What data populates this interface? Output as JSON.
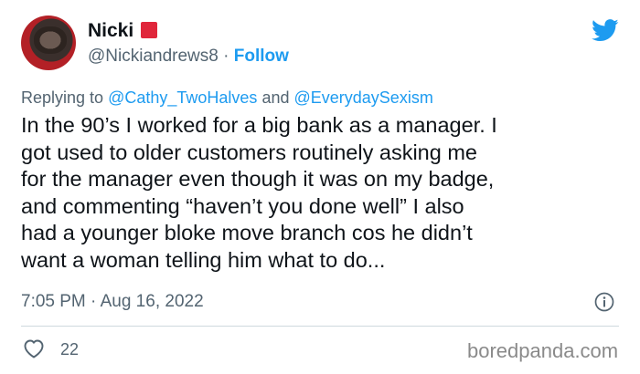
{
  "user": {
    "name": "Nicki",
    "handle": "@Nickiandrews8",
    "separator": "·",
    "follow_label": "Follow"
  },
  "reply": {
    "prefix": "Replying to",
    "mention1": "@Cathy_TwoHalves",
    "joiner": "and",
    "mention2": "@EverydaySexism"
  },
  "tweet": {
    "text": "In the 90’s I worked for a big bank as a manager. I\ngot used to older customers routinely asking  me\nfor the manager even though it was on my badge,\nand commenting “haven’t you done well” I also\nhad a younger bloke move branch cos he didn’t\nwant a woman telling him what to do...",
    "timestamp": "7:05 PM · Aug 16, 2022"
  },
  "stats": {
    "likes": "22"
  },
  "watermark": "boredpanda.com",
  "colors": {
    "accent": "#1d9bf0",
    "text": "#0f1419",
    "secondary": "#536471",
    "flag": "#e0263b"
  },
  "icons": [
    "twitter-bird-icon",
    "info-icon",
    "heart-icon",
    "red-square-emoji"
  ]
}
